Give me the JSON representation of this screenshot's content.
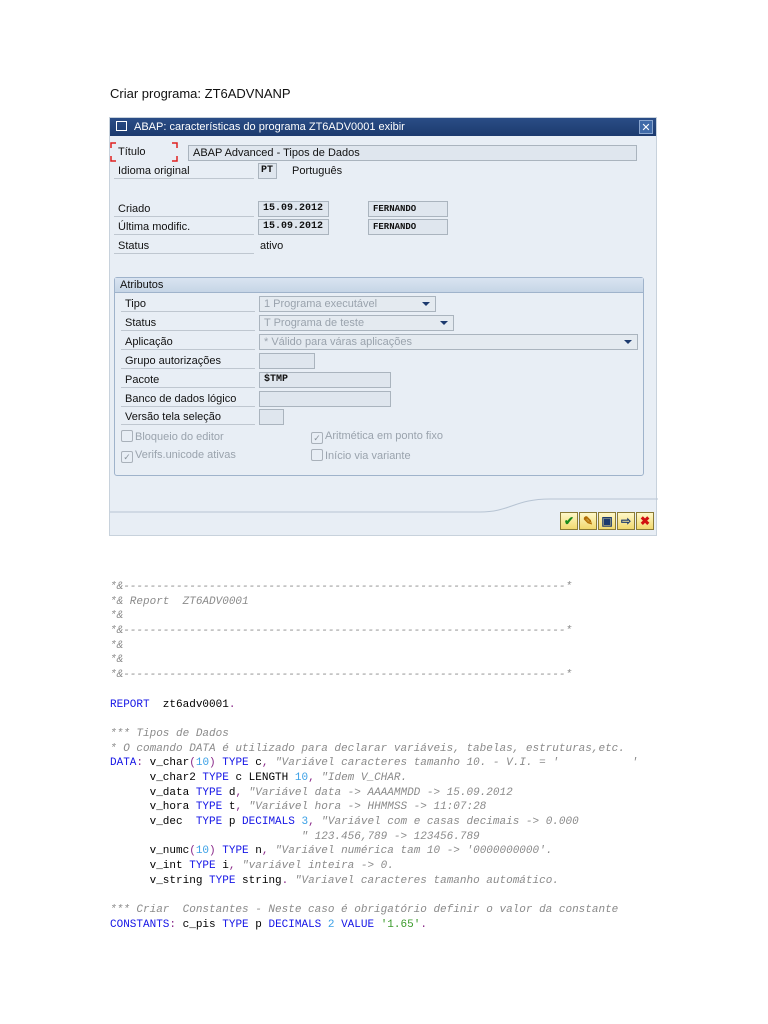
{
  "heading": "Criar programa: ZT6ADVNANP",
  "window": {
    "title": "ABAP: características do programa ZT6ADV0001 exibir",
    "close": "✕",
    "titulo_label": "Título",
    "titulo_value": "ABAP Advanced - Tipos de Dados",
    "idioma_label": "Idioma original",
    "idioma_code": "PT",
    "idioma_name": "Português",
    "criado_label": "Criado",
    "criado_date": "15.09.2012",
    "criado_user": "FERNANDO",
    "modif_label": "Última modific.",
    "modif_date": "15.09.2012",
    "modif_user": "FERNANDO",
    "status_label": "Status",
    "status_value": "ativo",
    "attr": {
      "title": "Atributos",
      "tipo_label": "Tipo",
      "tipo_value": "1 Programa executável",
      "status_label": "Status",
      "status_value": "T Programa de teste",
      "aplic_label": "Aplicação",
      "aplic_value": "* Válido para váras aplicações",
      "grupo_label": "Grupo autorizações",
      "grupo_value": "",
      "pacote_label": "Pacote",
      "pacote_value": "$TMP",
      "banco_label": "Banco de dados lógico",
      "banco_value": "",
      "versao_label": "Versão tela seleção",
      "versao_value": "",
      "cb_bloqueio": {
        "label": "Bloqueio do editor",
        "checked": false
      },
      "cb_aritmetica": {
        "label": "Aritmética em ponto fixo",
        "checked": true
      },
      "cb_unicode": {
        "label": "Verifs.unicode ativas",
        "checked": true
      },
      "cb_inicio": {
        "label": "Início via variante",
        "checked": false
      }
    },
    "buttons": [
      {
        "icon": "check-icon",
        "glyph": "✔"
      },
      {
        "icon": "edit-icon",
        "glyph": "✎"
      },
      {
        "icon": "display-icon",
        "glyph": "▣"
      },
      {
        "icon": "transfer-icon",
        "glyph": "⇨"
      },
      {
        "icon": "cancel-icon",
        "glyph": "✖"
      }
    ]
  },
  "code": [
    [
      [
        "c",
        "*&-------------------------------------------------------------------*"
      ]
    ],
    [
      [
        "c",
        "*& Report  ZT6ADV0001"
      ]
    ],
    [
      [
        "c",
        "*&"
      ]
    ],
    [
      [
        "c",
        "*&-------------------------------------------------------------------*"
      ]
    ],
    [
      [
        "c",
        "*&"
      ]
    ],
    [
      [
        "c",
        "*&"
      ]
    ],
    [
      [
        "c",
        "*&-------------------------------------------------------------------*"
      ]
    ],
    [],
    [
      [
        "k",
        "REPORT"
      ],
      [
        "i",
        "  zt6adv0001"
      ],
      [
        "p",
        "."
      ]
    ],
    [],
    [
      [
        "c",
        "*** Tipos de Dados"
      ]
    ],
    [
      [
        "c",
        "* O comando DATA é utilizado para declarar variáveis, tabelas, estruturas,etc."
      ]
    ],
    [
      [
        "k",
        "DATA"
      ],
      [
        "p",
        ":"
      ],
      [
        "i",
        " v_char"
      ],
      [
        "p",
        "("
      ],
      [
        "n",
        "10"
      ],
      [
        "p",
        ")"
      ],
      [
        "k",
        " TYPE"
      ],
      [
        "i",
        " c"
      ],
      [
        "p",
        ","
      ],
      [
        "c",
        " \"Variável caracteres tamanho 10. - V.I. = '           '"
      ]
    ],
    [
      [
        "i",
        "      v_char2"
      ],
      [
        "k",
        " TYPE"
      ],
      [
        "i",
        " c LENGTH "
      ],
      [
        "n",
        "10"
      ],
      [
        "p",
        ","
      ],
      [
        "c",
        " \"Idem V_CHAR."
      ]
    ],
    [
      [
        "i",
        "      v_data"
      ],
      [
        "k",
        " TYPE"
      ],
      [
        "i",
        " d"
      ],
      [
        "p",
        ","
      ],
      [
        "c",
        " \"Variável data -> AAAAMMDD -> 15.09.2012"
      ]
    ],
    [
      [
        "i",
        "      v_hora"
      ],
      [
        "k",
        " TYPE"
      ],
      [
        "i",
        " t"
      ],
      [
        "p",
        ","
      ],
      [
        "c",
        " \"Variável hora -> HHMMSS -> 11:07:28"
      ]
    ],
    [
      [
        "i",
        "      v_dec  "
      ],
      [
        "k",
        "TYPE"
      ],
      [
        "i",
        " p "
      ],
      [
        "k",
        "DECIMALS"
      ],
      [
        "n",
        " 3"
      ],
      [
        "p",
        ","
      ],
      [
        "c",
        " \"Variável com e casas decimais -> 0.000"
      ]
    ],
    [
      [
        "c",
        "                             \" 123.456,789 -> 123456.789"
      ]
    ],
    [
      [
        "i",
        "      v_numc"
      ],
      [
        "p",
        "("
      ],
      [
        "n",
        "10"
      ],
      [
        "p",
        ")"
      ],
      [
        "k",
        " TYPE"
      ],
      [
        "i",
        " n"
      ],
      [
        "p",
        ","
      ],
      [
        "c",
        " \"Variável numérica tam 10 -> '0000000000'."
      ]
    ],
    [
      [
        "i",
        "      v_int"
      ],
      [
        "k",
        " TYPE"
      ],
      [
        "i",
        " i"
      ],
      [
        "p",
        ","
      ],
      [
        "c",
        " \"variável inteira -> 0."
      ]
    ],
    [
      [
        "i",
        "      v_string"
      ],
      [
        "k",
        " TYPE"
      ],
      [
        "i",
        " string"
      ],
      [
        "p",
        "."
      ],
      [
        "c",
        " \"Variavel caracteres tamanho automático."
      ]
    ],
    [],
    [
      [
        "c",
        "*** Criar  Constantes - Neste caso é obrigatório definir o valor da constante"
      ]
    ],
    [
      [
        "k",
        "CONSTANTS"
      ],
      [
        "p",
        ":"
      ],
      [
        "i",
        " c_pis"
      ],
      [
        "k",
        " TYPE"
      ],
      [
        "i",
        " p "
      ],
      [
        "k",
        "DECIMALS"
      ],
      [
        "n",
        " 2"
      ],
      [
        "k",
        " VALUE"
      ],
      [
        "s",
        " '1.65'"
      ],
      [
        "p",
        "."
      ]
    ]
  ]
}
